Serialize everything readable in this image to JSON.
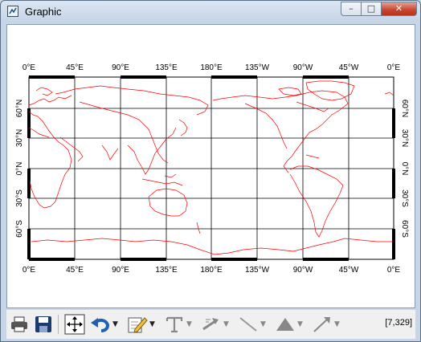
{
  "window": {
    "title": "Graphic",
    "minimize": "–",
    "maximize": "□",
    "close": "✕"
  },
  "map": {
    "top_lon_labels": [
      "0°E",
      "45°E",
      "90°E",
      "135°E",
      "180°E",
      "135°W",
      "90°W",
      "45°W",
      "0°E"
    ],
    "bottom_lon_labels": [
      "0°E",
      "45°E",
      "90°E",
      "135°E",
      "180°E",
      "135°W",
      "90°W",
      "45°W",
      "0°E"
    ],
    "lat_labels": [
      "60°N",
      "30°N",
      "0°N",
      "30°S",
      "60°S"
    ],
    "coastline_color": "#ff0000",
    "grid_color": "#000000"
  },
  "toolbar": {
    "icons": [
      "printer-icon",
      "save-icon",
      "pan-zoom-icon",
      "undo-icon",
      "annotate-icon",
      "text-icon",
      "arrow-style-icon",
      "line-icon",
      "polygon-icon",
      "pointer-arrow-icon"
    ],
    "coordinates": "[7,329]"
  }
}
